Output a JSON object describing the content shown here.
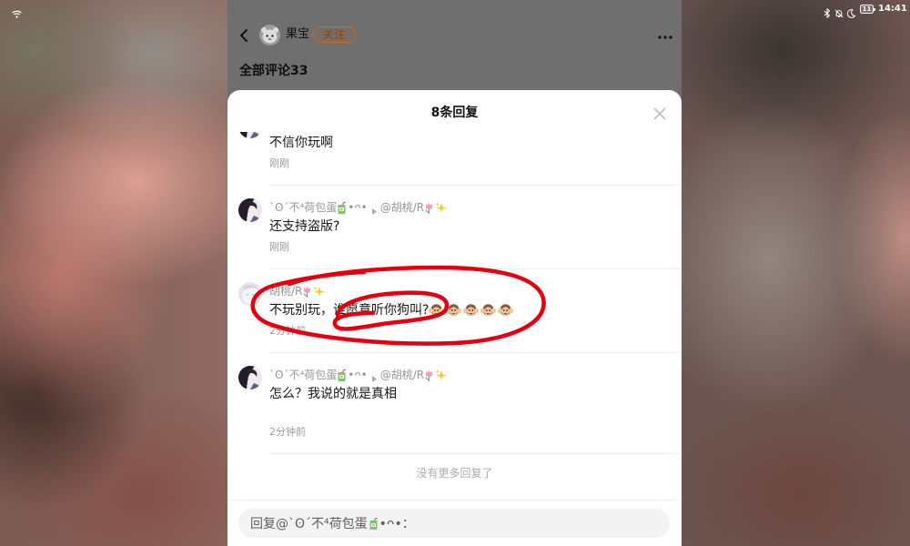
{
  "status_bar": {
    "time": "14:41",
    "battery_level": "11",
    "icons": [
      "wifi-icon",
      "bluetooth-icon",
      "bell-off-icon",
      "moon-icon",
      "battery-icon"
    ]
  },
  "post_header": {
    "back_icon": "chevron-left-icon",
    "author_name": "果宝",
    "follow_label": "关注",
    "more_icon": "more-horizontal-icon"
  },
  "comments": {
    "title": "全部评论33"
  },
  "sheet": {
    "title": "8条回复",
    "close_icon": "close-icon",
    "replies": [
      {
        "text": "不信你玩啊",
        "time": "刚刚"
      },
      {
        "author": "`ʘ´不⁴荷包蛋",
        "author_emoji": "juice-box-icon",
        "author_tail": "•ᴖ•",
        "reply_to": "@胡桃/R",
        "reply_to_emojis": [
          "tulip-icon",
          "sparkles-icon"
        ],
        "text": "还支持盗版?",
        "time": "刚刚"
      },
      {
        "author": "胡桃/R",
        "author_emojis": [
          "tulip-icon",
          "sparkles-icon"
        ],
        "text": "不玩别玩，谁愿意听你狗叫?",
        "text_emojis": [
          "hear-no-evil-monkey-icon",
          "hear-no-evil-monkey-icon",
          "hear-no-evil-monkey-icon",
          "hear-no-evil-monkey-icon",
          "hear-no-evil-monkey-icon"
        ],
        "time": "2分钟前"
      },
      {
        "author": "`ʘ´不⁴荷包蛋",
        "author_emoji": "juice-box-icon",
        "author_tail": "•ᴖ•",
        "reply_to": "@胡桃/R",
        "reply_to_emojis": [
          "tulip-icon",
          "sparkles-icon"
        ],
        "text": "怎么？我说的就是真相",
        "time": "2分钟前"
      }
    ],
    "end_text": "没有更多回复了",
    "reply_input": {
      "prefix": "回复@`ʘ´不⁴荷包蛋",
      "emoji": "juice-box-icon",
      "suffix": "•ᴖ•："
    }
  },
  "colors": {
    "dim": "#6f6f6f",
    "follow": "#c9691f",
    "annotation": "#e4000f"
  }
}
